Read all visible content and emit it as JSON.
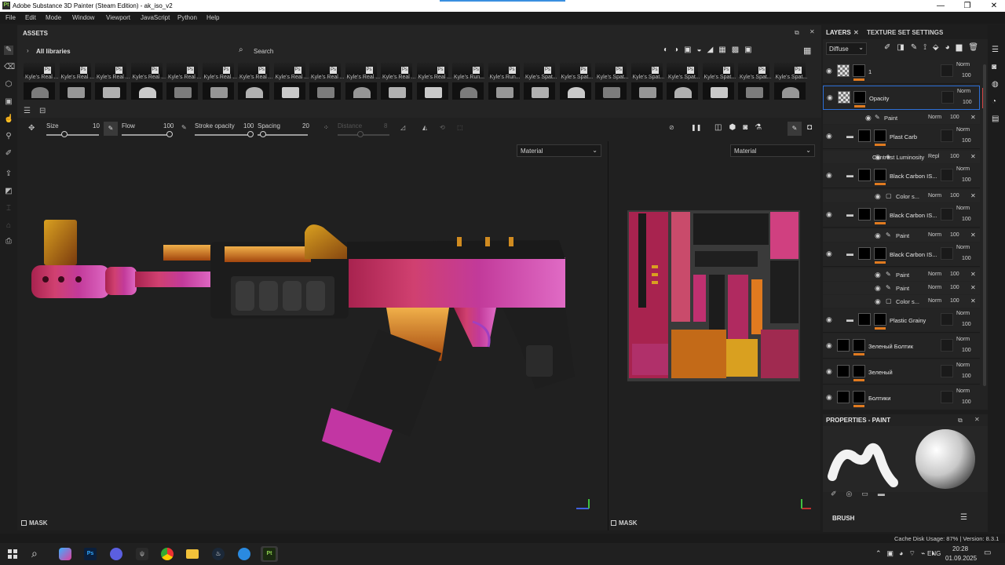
{
  "window": {
    "title": "Adobe Substance 3D Painter (Steam Edition) - ak_iso_v2",
    "logo": "Pt",
    "min": "—",
    "max": "❐",
    "close": "✕"
  },
  "menu": [
    "File",
    "Edit",
    "Mode",
    "Window",
    "Viewport",
    "JavaScript",
    "Python",
    "Help"
  ],
  "assets": {
    "title": "ASSETS",
    "all_libraries": "All libraries",
    "search_placeholder": "Search",
    "brush_labels": [
      "Kyle's Real ...",
      "Kyle's Real ...",
      "Kyle's Real ...",
      "Kyle's Real ...",
      "Kyle's Real ...",
      "Kyle's Real ...",
      "Kyle's Real ...",
      "Kyle's Real ...",
      "Kyle's Real ...",
      "Kyle's Real ...",
      "Kyle's Real ...",
      "Kyle's Real ...",
      "Kyle's Run...",
      "Kyle's Run...",
      "Kyle's Spat...",
      "Kyle's Spat...",
      "Kyle's Spat...",
      "Kyle's Spat...",
      "Kyle's Spat...",
      "Kyle's Spat...",
      "Kyle's Spat...",
      "Kyle's Spat..."
    ],
    "ps_badge": "Ps"
  },
  "brush": {
    "size_label": "Size",
    "size_value": "10",
    "flow_label": "Flow",
    "flow_value": "100",
    "stroke_opacity_label": "Stroke opacity",
    "stroke_opacity_value": "100",
    "spacing_label": "Spacing",
    "spacing_value": "20",
    "distance_label": "Distance",
    "distance_value": "8"
  },
  "viewport": {
    "left_channel": "Material",
    "right_channel": "Material",
    "mask_left": "MASK",
    "mask_right": "MASK"
  },
  "layers": {
    "tab_layers": "LAYERS",
    "tab_tss": "TEXTURE SET SETTINGS",
    "channel": "Diffuse",
    "items": [
      {
        "name": "1",
        "blend": "Norm",
        "opacity": "100"
      },
      {
        "name": "Opacity",
        "blend": "Norm",
        "opacity": "100",
        "sub": [
          {
            "name": "Paint",
            "blend": "Norm",
            "opacity": "100"
          }
        ]
      },
      {
        "name": "Plast Carb",
        "blend": "Norm",
        "opacity": "100",
        "sub": [
          {
            "name": "Contrast Luminosity",
            "blend": "Repl",
            "opacity": "100"
          }
        ]
      },
      {
        "name": "Black Carbon IS...",
        "blend": "Norm",
        "opacity": "100",
        "sub": [
          {
            "name": "Color s...",
            "blend": "Norm",
            "opacity": "100"
          }
        ]
      },
      {
        "name": "Black Carbon IS...",
        "blend": "Norm",
        "opacity": "100",
        "sub": [
          {
            "name": "Paint",
            "blend": "Norm",
            "opacity": "100"
          }
        ]
      },
      {
        "name": "Black Carbon IS...",
        "blend": "Norm",
        "opacity": "100",
        "sub": [
          {
            "name": "Paint",
            "blend": "Norm",
            "opacity": "100"
          },
          {
            "name": "Paint",
            "blend": "Norm",
            "opacity": "100"
          },
          {
            "name": "Color s...",
            "blend": "Norm",
            "opacity": "100"
          }
        ]
      },
      {
        "name": "Plastic Grainy",
        "blend": "Norm",
        "opacity": "100"
      },
      {
        "name": "Зеленый Болтик",
        "blend": "Norm",
        "opacity": "100"
      },
      {
        "name": "Зеленый",
        "blend": "Norm",
        "opacity": "100"
      },
      {
        "name": "Болтики",
        "blend": "Norm",
        "opacity": "100"
      }
    ]
  },
  "properties": {
    "title": "PROPERTIES - PAINT",
    "section": "BRUSH"
  },
  "status": {
    "text": "Cache Disk Usage:  87% | Version: 8.3.1"
  },
  "taskbar": {
    "lang": "ENG",
    "time": "20:28",
    "date": "01.09.2025"
  },
  "colors": {
    "accent": "#e07a1f",
    "selected": "#2d6fd6",
    "ruby": "#c03060",
    "gold": "#d99a20",
    "magenta": "#c040b0"
  }
}
